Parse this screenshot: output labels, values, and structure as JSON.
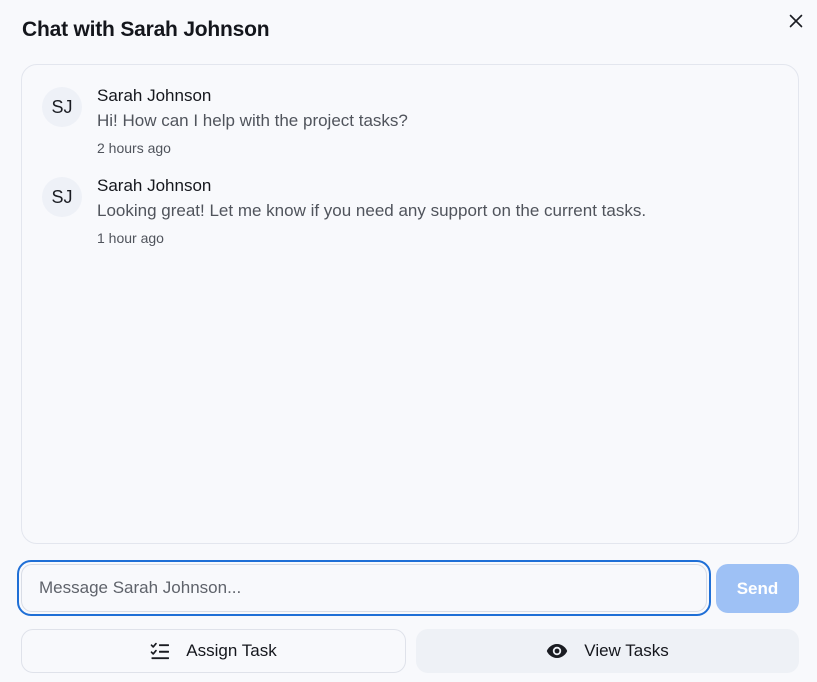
{
  "dialog": {
    "title": "Chat with Sarah Johnson",
    "close_icon": "close-icon"
  },
  "messages": [
    {
      "avatar_initials": "SJ",
      "sender": "Sarah Johnson",
      "text": "Hi! How can I help with the project tasks?",
      "time": "2 hours ago"
    },
    {
      "avatar_initials": "SJ",
      "sender": "Sarah Johnson",
      "text": "Looking great! Let me know if you need any support on the current tasks.",
      "time": "1 hour ago"
    }
  ],
  "composer": {
    "placeholder": "Message Sarah Johnson...",
    "value": "",
    "send_label": "Send"
  },
  "actions": {
    "assign_label": "Assign Task",
    "assign_icon": "task-list-icon",
    "view_label": "View Tasks",
    "view_icon": "eye-icon"
  },
  "colors": {
    "accent": "#1f6fd6",
    "send_disabled": "#9ec1f5"
  }
}
